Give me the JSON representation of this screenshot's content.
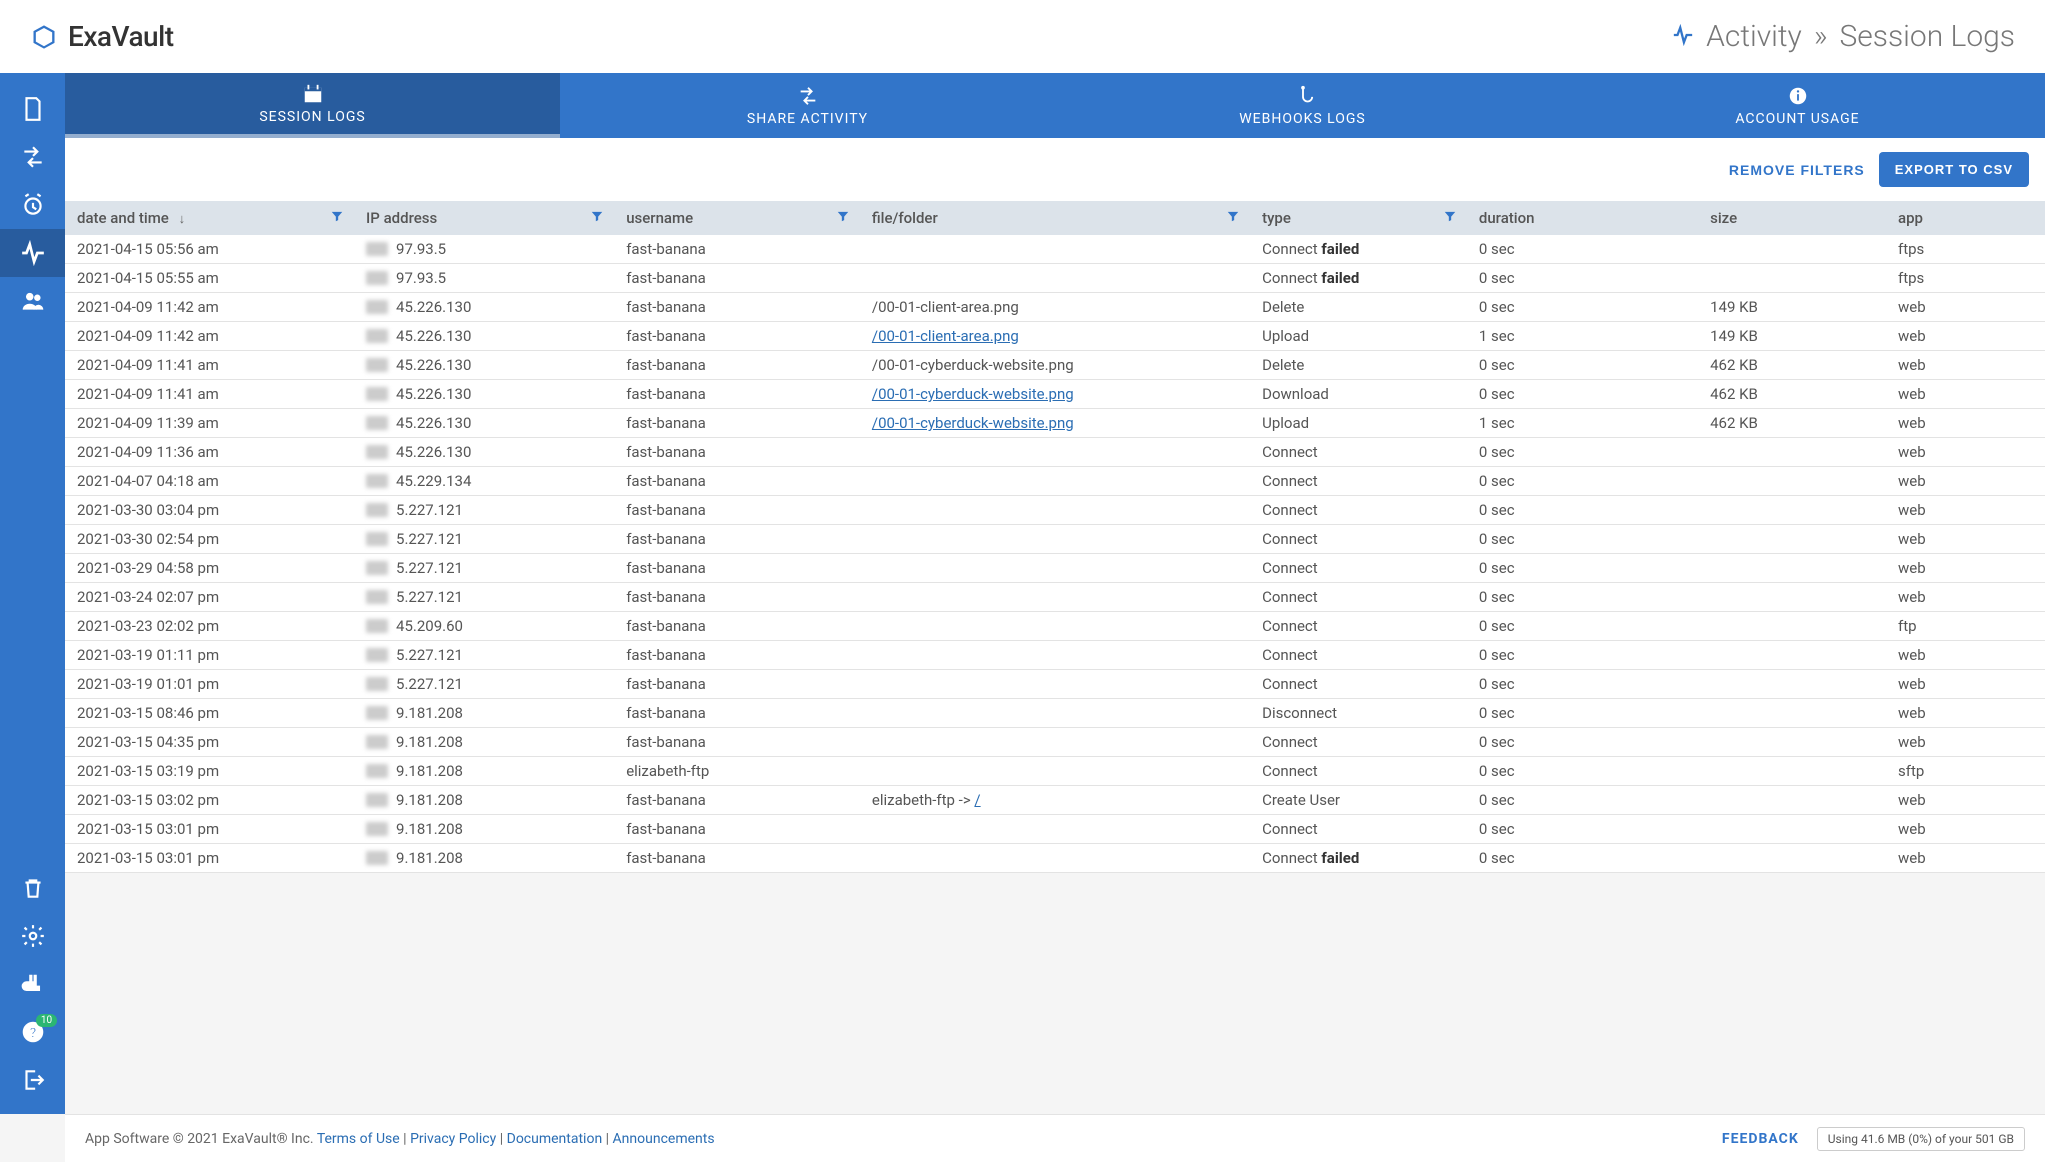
{
  "brand": "ExaVault",
  "breadcrumb": {
    "activity": "Activity",
    "sep": "»",
    "page": "Session Logs"
  },
  "tabs": {
    "session": "SESSION LOGS",
    "share": "SHARE ACTIVITY",
    "webhooks": "WEBHOOKS LOGS",
    "account": "ACCOUNT USAGE"
  },
  "toolbar": {
    "remove": "REMOVE FILTERS",
    "export": "EXPORT TO CSV"
  },
  "columns": {
    "date": "date and time",
    "ip": "IP address",
    "user": "username",
    "file": "file/folder",
    "type": "type",
    "duration": "duration",
    "size": "size",
    "app": "app"
  },
  "sidebar_badge": "10",
  "rows": [
    {
      "date": "2021-04-15 05:56 am",
      "ip": "97.93.5",
      "user": "fast-banana",
      "file": "",
      "link": false,
      "typePrefix": "Connect",
      "typeBold": " failed",
      "dur": "0 sec",
      "size": "",
      "app": "ftps"
    },
    {
      "date": "2021-04-15 05:55 am",
      "ip": "97.93.5",
      "user": "fast-banana",
      "file": "",
      "link": false,
      "typePrefix": "Connect",
      "typeBold": " failed",
      "dur": "0 sec",
      "size": "",
      "app": "ftps"
    },
    {
      "date": "2021-04-09 11:42 am",
      "ip": "45.226.130",
      "user": "fast-banana",
      "file": "/00-01-client-area.png",
      "link": false,
      "typePrefix": "Delete",
      "typeBold": "",
      "dur": "0 sec",
      "size": "149 KB",
      "app": "web"
    },
    {
      "date": "2021-04-09 11:42 am",
      "ip": "45.226.130",
      "user": "fast-banana",
      "file": "/00-01-client-area.png",
      "link": true,
      "typePrefix": "Upload",
      "typeBold": "",
      "dur": "1 sec",
      "size": "149 KB",
      "app": "web"
    },
    {
      "date": "2021-04-09 11:41 am",
      "ip": "45.226.130",
      "user": "fast-banana",
      "file": "/00-01-cyberduck-website.png",
      "link": false,
      "typePrefix": "Delete",
      "typeBold": "",
      "dur": "0 sec",
      "size": "462 KB",
      "app": "web"
    },
    {
      "date": "2021-04-09 11:41 am",
      "ip": "45.226.130",
      "user": "fast-banana",
      "file": "/00-01-cyberduck-website.png",
      "link": true,
      "typePrefix": "Download",
      "typeBold": "",
      "dur": "0 sec",
      "size": "462 KB",
      "app": "web"
    },
    {
      "date": "2021-04-09 11:39 am",
      "ip": "45.226.130",
      "user": "fast-banana",
      "file": "/00-01-cyberduck-website.png",
      "link": true,
      "typePrefix": "Upload",
      "typeBold": "",
      "dur": "1 sec",
      "size": "462 KB",
      "app": "web"
    },
    {
      "date": "2021-04-09 11:36 am",
      "ip": "45.226.130",
      "user": "fast-banana",
      "file": "",
      "link": false,
      "typePrefix": "Connect",
      "typeBold": "",
      "dur": "0 sec",
      "size": "",
      "app": "web"
    },
    {
      "date": "2021-04-07 04:18 am",
      "ip": "45.229.134",
      "user": "fast-banana",
      "file": "",
      "link": false,
      "typePrefix": "Connect",
      "typeBold": "",
      "dur": "0 sec",
      "size": "",
      "app": "web"
    },
    {
      "date": "2021-03-30 03:04 pm",
      "ip": "5.227.121",
      "user": "fast-banana",
      "file": "",
      "link": false,
      "typePrefix": "Connect",
      "typeBold": "",
      "dur": "0 sec",
      "size": "",
      "app": "web"
    },
    {
      "date": "2021-03-30 02:54 pm",
      "ip": "5.227.121",
      "user": "fast-banana",
      "file": "",
      "link": false,
      "typePrefix": "Connect",
      "typeBold": "",
      "dur": "0 sec",
      "size": "",
      "app": "web"
    },
    {
      "date": "2021-03-29 04:58 pm",
      "ip": "5.227.121",
      "user": "fast-banana",
      "file": "",
      "link": false,
      "typePrefix": "Connect",
      "typeBold": "",
      "dur": "0 sec",
      "size": "",
      "app": "web"
    },
    {
      "date": "2021-03-24 02:07 pm",
      "ip": "5.227.121",
      "user": "fast-banana",
      "file": "",
      "link": false,
      "typePrefix": "Connect",
      "typeBold": "",
      "dur": "0 sec",
      "size": "",
      "app": "web"
    },
    {
      "date": "2021-03-23 02:02 pm",
      "ip": "45.209.60",
      "user": "fast-banana",
      "file": "",
      "link": false,
      "typePrefix": "Connect",
      "typeBold": "",
      "dur": "0 sec",
      "size": "",
      "app": "ftp"
    },
    {
      "date": "2021-03-19 01:11 pm",
      "ip": "5.227.121",
      "user": "fast-banana",
      "file": "",
      "link": false,
      "typePrefix": "Connect",
      "typeBold": "",
      "dur": "0 sec",
      "size": "",
      "app": "web"
    },
    {
      "date": "2021-03-19 01:01 pm",
      "ip": "5.227.121",
      "user": "fast-banana",
      "file": "",
      "link": false,
      "typePrefix": "Connect",
      "typeBold": "",
      "dur": "0 sec",
      "size": "",
      "app": "web"
    },
    {
      "date": "2021-03-15 08:46 pm",
      "ip": "9.181.208",
      "user": "fast-banana",
      "file": "",
      "link": false,
      "typePrefix": "Disconnect",
      "typeBold": "",
      "dur": "0 sec",
      "size": "",
      "app": "web"
    },
    {
      "date": "2021-03-15 04:35 pm",
      "ip": "9.181.208",
      "user": "fast-banana",
      "file": "",
      "link": false,
      "typePrefix": "Connect",
      "typeBold": "",
      "dur": "0 sec",
      "size": "",
      "app": "web"
    },
    {
      "date": "2021-03-15 03:19 pm",
      "ip": "9.181.208",
      "user": "elizabeth-ftp",
      "file": "",
      "link": false,
      "typePrefix": "Connect",
      "typeBold": "",
      "dur": "0 sec",
      "size": "",
      "app": "sftp"
    },
    {
      "date": "2021-03-15 03:02 pm",
      "ip": "9.181.208",
      "user": "fast-banana",
      "fileHtmlPrefix": "elizabeth-ftp -> ",
      "file": "/",
      "link": true,
      "typePrefix": "Create User",
      "typeBold": "",
      "dur": "0 sec",
      "size": "",
      "app": "web"
    },
    {
      "date": "2021-03-15 03:01 pm",
      "ip": "9.181.208",
      "user": "fast-banana",
      "file": "",
      "link": false,
      "typePrefix": "Connect",
      "typeBold": "",
      "dur": "0 sec",
      "size": "",
      "app": "web"
    },
    {
      "date": "2021-03-15 03:01 pm",
      "ip": "9.181.208",
      "user": "fast-banana",
      "file": "",
      "link": false,
      "typePrefix": "Connect",
      "typeBold": " failed",
      "dur": "0 sec",
      "size": "",
      "app": "web"
    }
  ],
  "footer": {
    "copyright": "App Software © 2021 ExaVault® Inc.",
    "terms": "Terms of Use",
    "privacy": "Privacy Policy",
    "docs": "Documentation",
    "announcements": "Announcements",
    "sep": " | ",
    "feedback": "FEEDBACK",
    "storage": "Using 41.6 MB (0%) of your 501 GB"
  }
}
